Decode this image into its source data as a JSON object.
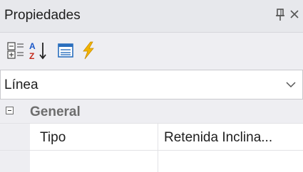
{
  "window": {
    "title": "Propiedades",
    "pin_glyph": "ᵽ",
    "close_glyph": "×"
  },
  "toolbar": {
    "buttons": [
      {
        "name": "categorized-icon"
      },
      {
        "name": "alphabetical-icon"
      },
      {
        "name": "properties-page-icon"
      },
      {
        "name": "events-icon"
      }
    ]
  },
  "selector": {
    "value": "Línea"
  },
  "grid": {
    "category": "General",
    "rows": [
      {
        "name": "Tipo",
        "value": "Retenida Inclina..."
      }
    ]
  },
  "colors": {
    "background": "#ffffff",
    "panel": "#eeeef2",
    "titlebar": "#e7e8ec",
    "category_text": "#6d6d6d",
    "events_icon": "#f2b400"
  }
}
